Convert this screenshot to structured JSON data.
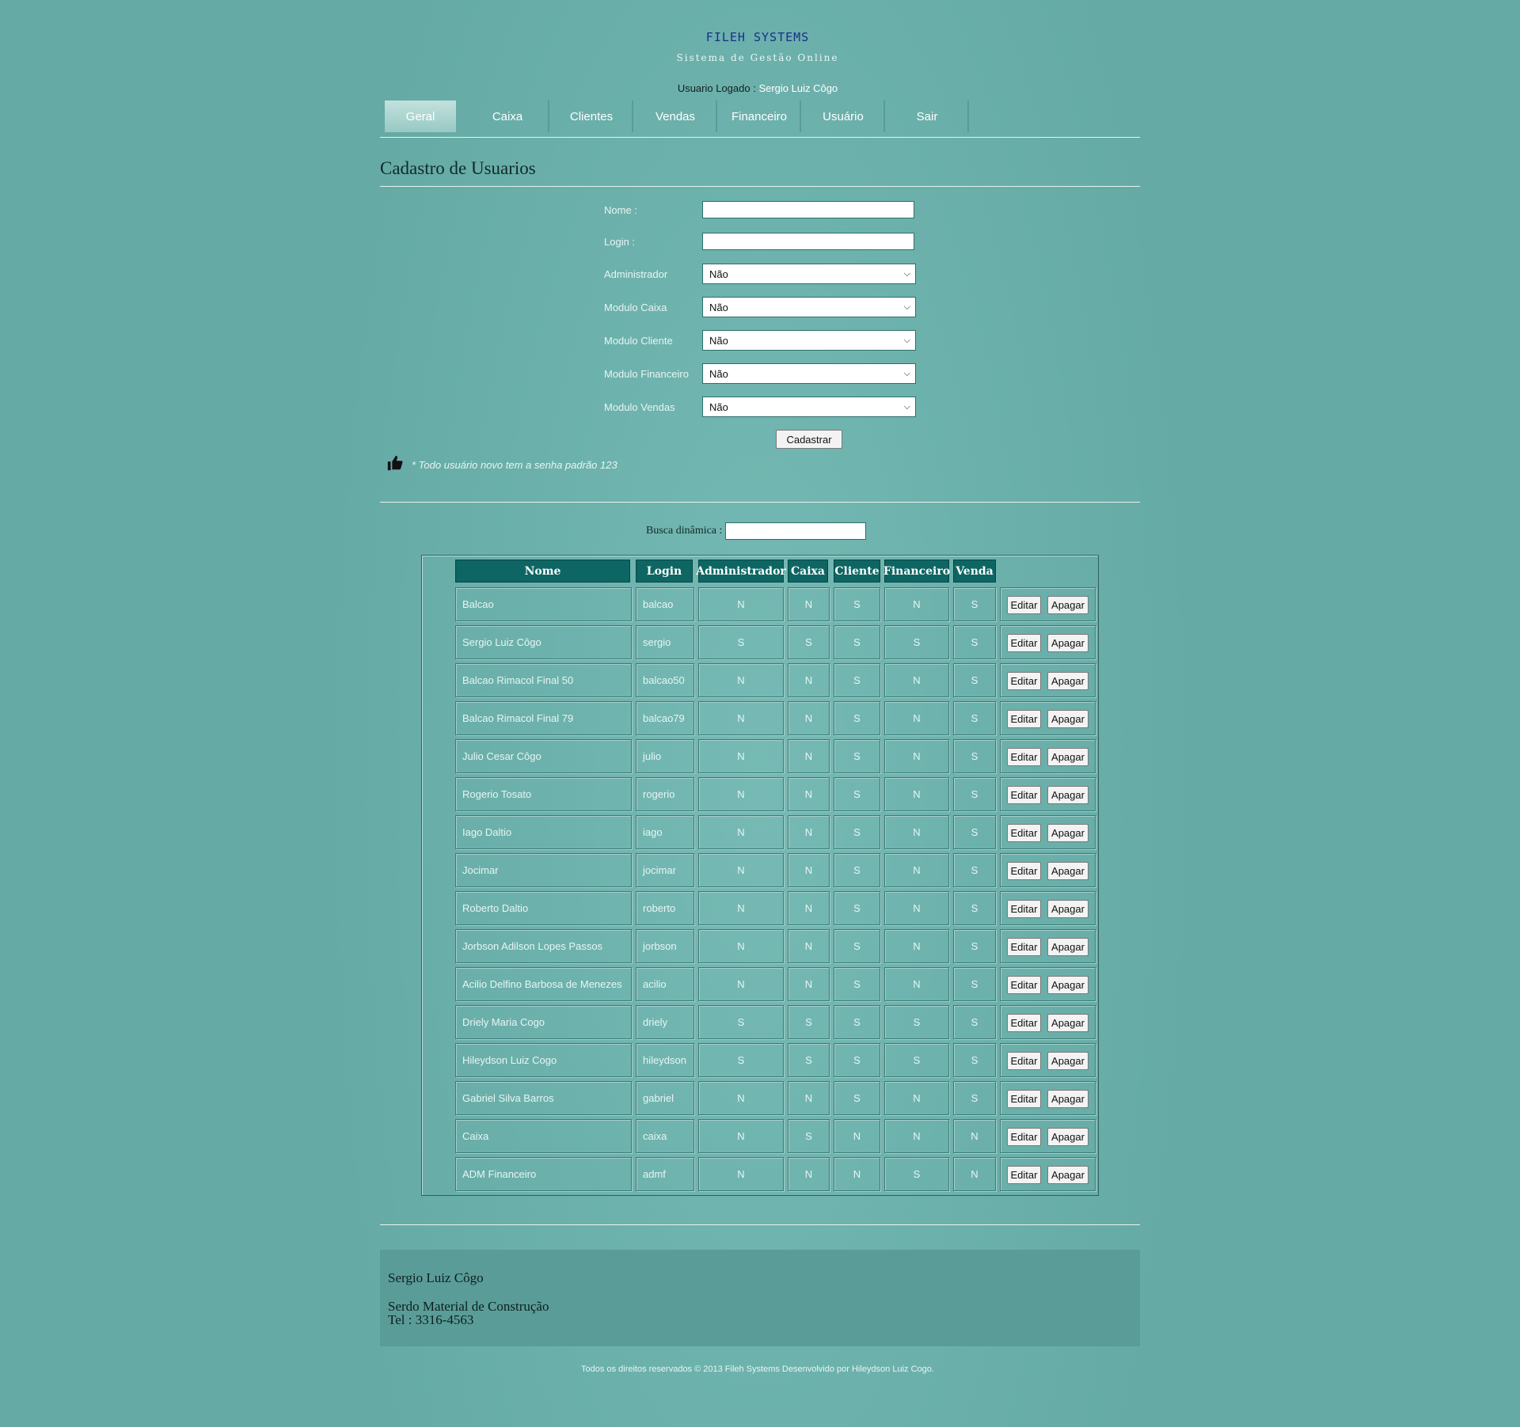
{
  "header": {
    "brand": "FILEH SYSTEMS",
    "tagline": "Sistema de Gestão Online",
    "logged_label": "Usuario Logado : ",
    "logged_user": "Sergio Luiz Côgo"
  },
  "nav": [
    "Geral",
    "Caixa",
    "Clientes",
    "Vendas",
    "Financeiro",
    "Usuário",
    "Sair"
  ],
  "page_title": "Cadastro de Usuarios",
  "form": {
    "nome_label": "Nome :",
    "login_label": "Login :",
    "selects": [
      {
        "label": "Administrador",
        "value": "Não"
      },
      {
        "label": "Modulo Caixa",
        "value": "Não"
      },
      {
        "label": "Modulo Cliente",
        "value": "Não"
      },
      {
        "label": "Modulo Financeiro",
        "value": "Não"
      },
      {
        "label": "Modulo Vendas",
        "value": "Não"
      }
    ],
    "submit": "Cadastrar",
    "note": "* Todo usuário novo tem a senha padrão 123"
  },
  "search": {
    "label": "Busca dinâmica :"
  },
  "table": {
    "headers": [
      "Nome",
      "Login",
      "Administrador",
      "Caixa",
      "Cliente",
      "Financeiro",
      "Venda"
    ],
    "edit_label": "Editar",
    "delete_label": "Apagar",
    "rows": [
      [
        "Balcao",
        "balcao",
        "N",
        "N",
        "S",
        "N",
        "S"
      ],
      [
        "Sergio Luiz Côgo",
        "sergio",
        "S",
        "S",
        "S",
        "S",
        "S"
      ],
      [
        "Balcao Rimacol Final 50",
        "balcao50",
        "N",
        "N",
        "S",
        "N",
        "S"
      ],
      [
        "Balcao Rimacol Final 79",
        "balcao79",
        "N",
        "N",
        "S",
        "N",
        "S"
      ],
      [
        "Julio Cesar Côgo",
        "julio",
        "N",
        "N",
        "S",
        "N",
        "S"
      ],
      [
        "Rogerio Tosato",
        "rogerio",
        "N",
        "N",
        "S",
        "N",
        "S"
      ],
      [
        "Iago Daltio",
        "iago",
        "N",
        "N",
        "S",
        "N",
        "S"
      ],
      [
        "Jocimar",
        "jocimar",
        "N",
        "N",
        "S",
        "N",
        "S"
      ],
      [
        "Roberto Daltio",
        "roberto",
        "N",
        "N",
        "S",
        "N",
        "S"
      ],
      [
        "Jorbson Adilson Lopes Passos",
        "jorbson",
        "N",
        "N",
        "S",
        "N",
        "S"
      ],
      [
        "Acilio Delfino Barbosa de Menezes",
        "acilio",
        "N",
        "N",
        "S",
        "N",
        "S"
      ],
      [
        "Driely Maria Cogo",
        "driely",
        "S",
        "S",
        "S",
        "S",
        "S"
      ],
      [
        "Hileydson Luiz Cogo",
        "hileydson",
        "S",
        "S",
        "S",
        "S",
        "S"
      ],
      [
        "Gabriel Silva Barros",
        "gabriel",
        "N",
        "N",
        "S",
        "N",
        "S"
      ],
      [
        "Caixa",
        "caixa",
        "N",
        "S",
        "N",
        "N",
        "N"
      ],
      [
        "ADM Financeiro",
        "admf",
        "N",
        "N",
        "N",
        "S",
        "N"
      ]
    ]
  },
  "footer": {
    "name": "Sergio Luiz Côgo",
    "company": "Serdo Material de Construção",
    "tel": "Tel : 3316-4563",
    "copyright": "Todos os direitos reservados © 2013 Fileh Systems Desenvolvido por Hileydson Luiz Cogo."
  }
}
